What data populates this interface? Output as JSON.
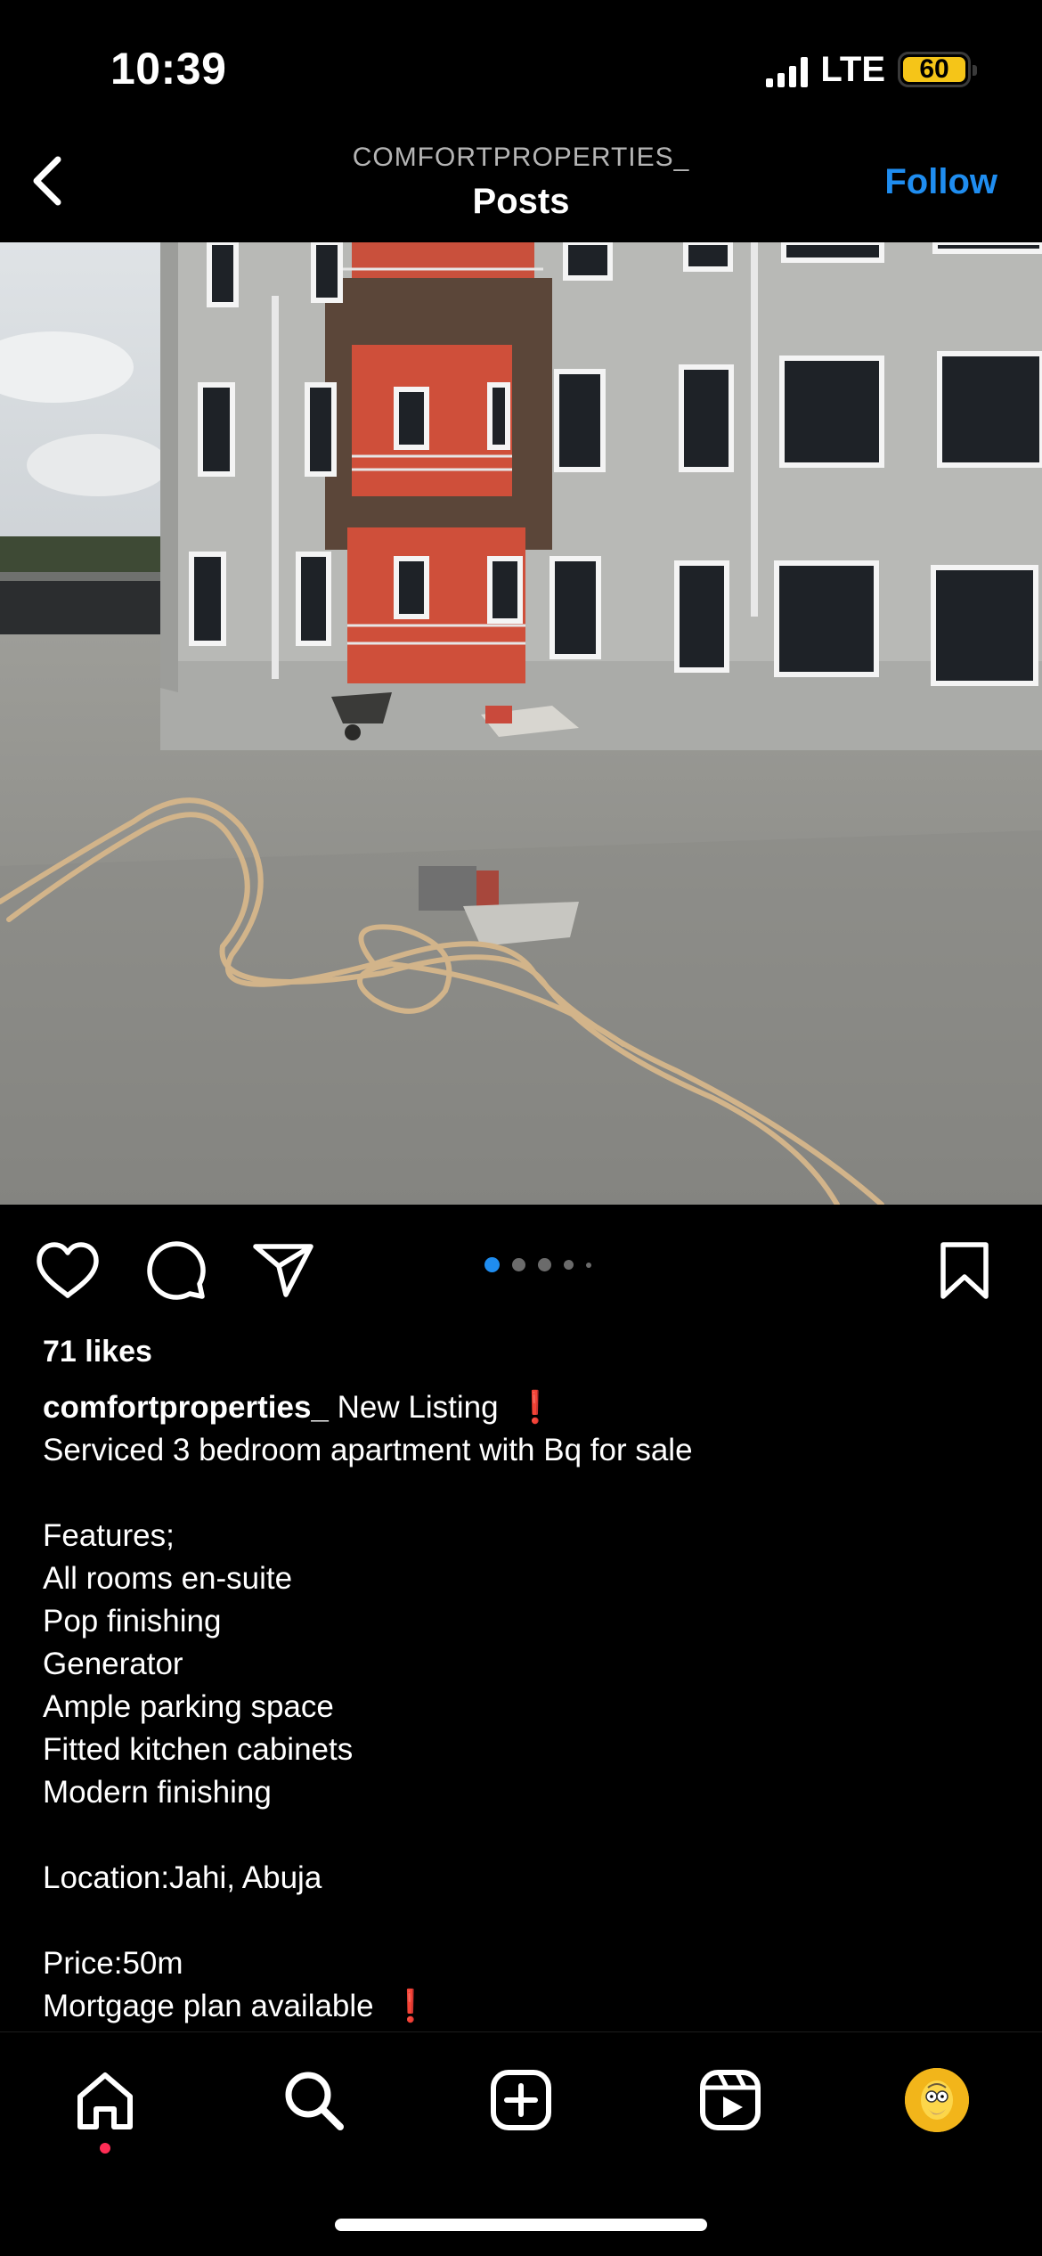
{
  "status_bar": {
    "time": "10:39",
    "network": "LTE",
    "battery": "60"
  },
  "header": {
    "username": "COMFORTPROPERTIES_",
    "title": "Posts",
    "follow_label": "Follow"
  },
  "post": {
    "carousel": {
      "total": 5,
      "active": 1
    },
    "likes": "71 likes",
    "username": "comfortproperties_",
    "first_line": "New Listing",
    "caption_lines": [
      "Serviced 3 bedroom apartment with Bq for sale",
      "",
      "Features;",
      "All rooms en-suite",
      "Pop finishing",
      "Generator",
      "Ample parking space",
      "Fitted kitchen cabinets",
      "Modern finishing",
      "",
      "Location:Jahi, Abuja",
      "",
      "Price:50m",
      "Mortgage plan available"
    ],
    "exclamation": "❗"
  },
  "icons": {
    "back": "chevron-left-icon",
    "like": "heart-icon",
    "comment": "comment-icon",
    "share": "send-icon",
    "save": "bookmark-icon",
    "home": "home-icon",
    "search": "search-icon",
    "create": "plus-square-icon",
    "reels": "reels-icon",
    "profile": "avatar"
  },
  "colors": {
    "accent": "#1f8df0",
    "battery": "#f5c518",
    "alert": "#e0261b",
    "notification": "#ff2d55"
  }
}
